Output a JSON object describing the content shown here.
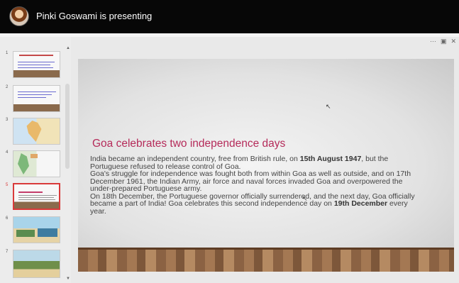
{
  "header": {
    "presenter_text": "Pinki Goswami is presenting"
  },
  "toolbar": {
    "more_glyph": "···",
    "present_glyph": "▣",
    "close_glyph": "✕"
  },
  "sidebar": {
    "slide_numbers": [
      "1",
      "2",
      "3",
      "4",
      "5",
      "6",
      "7"
    ]
  },
  "slide": {
    "title": "Goa celebrates two independence days",
    "p1_pre": "India became an independent country, free from British rule, on ",
    "p1_bold": "15th August 1947",
    "p1_post": ", but the Portuguese refused to release control of Goa.",
    "p2": "Goa's struggle for independence was fought both from within Goa as well as outside, and on 17th December 1961, the Indian Army, air force and naval forces invaded Goa and overpowered the under-prepared Portuguese army.",
    "p3_pre": "On 18th December, the Portuguese governor officially surrendered, and the next day, Goa officially became a part of India! Goa celebrates this second independence day on ",
    "p3_bold": "19th December",
    "p3_post": " every year."
  }
}
